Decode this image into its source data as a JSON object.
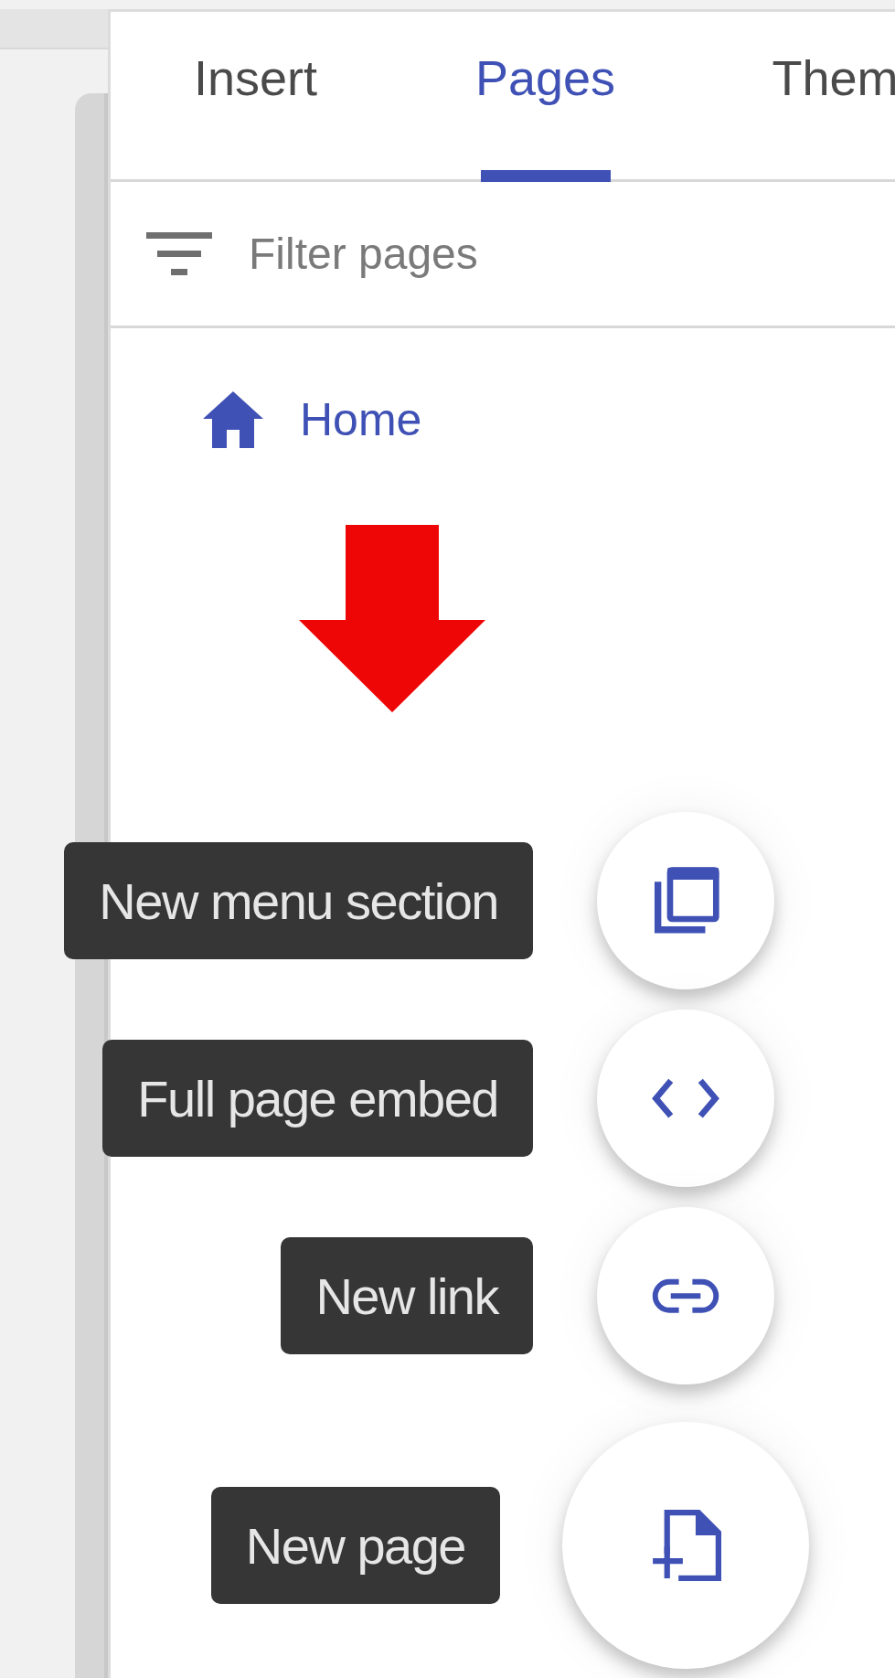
{
  "tabs": [
    {
      "label": "Insert",
      "selected": false
    },
    {
      "label": "Pages",
      "selected": true
    },
    {
      "label": "Them",
      "selected": false
    }
  ],
  "filter": {
    "placeholder": "Filter pages"
  },
  "pages": [
    {
      "title": "Home",
      "kind": "home"
    }
  ],
  "speed_dial": [
    {
      "label": "New menu section",
      "kind": "section"
    },
    {
      "label": "Full page embed",
      "kind": "embed"
    },
    {
      "label": "New link",
      "kind": "link"
    },
    {
      "label": "New page",
      "kind": "page"
    }
  ]
}
